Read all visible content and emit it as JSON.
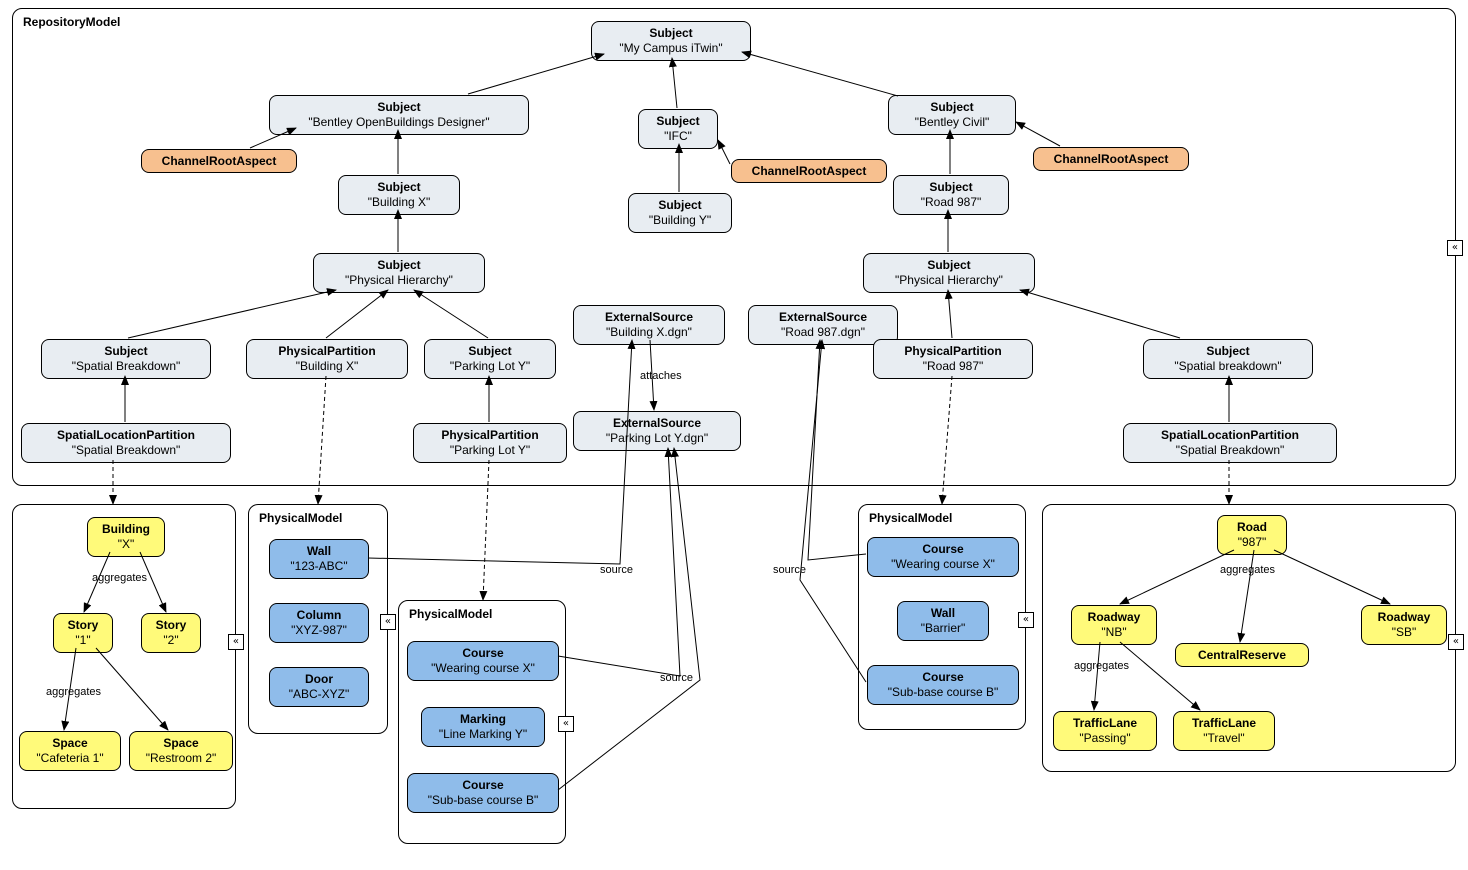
{
  "repo_title": "RepositoryModel",
  "nodes": {
    "root": {
      "t": "Subject",
      "l": "\"My Campus iTwin\""
    },
    "obd": {
      "t": "Subject",
      "l": "\"Bentley OpenBuildings Designer\""
    },
    "ifc": {
      "t": "Subject",
      "l": "\"IFC\""
    },
    "civil": {
      "t": "Subject",
      "l": "\"Bentley Civil\""
    },
    "cra1": {
      "t": "ChannelRootAspect"
    },
    "cra2": {
      "t": "ChannelRootAspect"
    },
    "cra3": {
      "t": "ChannelRootAspect"
    },
    "bx": {
      "t": "Subject",
      "l": "\"Building X\""
    },
    "by": {
      "t": "Subject",
      "l": "\"Building Y\""
    },
    "r987s": {
      "t": "Subject",
      "l": "\"Road 987\""
    },
    "ph1": {
      "t": "Subject",
      "l": "\"Physical Hierarchy\""
    },
    "ph2": {
      "t": "Subject",
      "l": "\"Physical Hierarchy\""
    },
    "sbk1": {
      "t": "Subject",
      "l": "\"Spatial Breakdown\""
    },
    "ppbx": {
      "t": "PhysicalPartition",
      "l": "\"Building X\""
    },
    "sply": {
      "t": "Subject",
      "l": "\"Parking Lot Y\""
    },
    "ppply": {
      "t": "PhysicalPartition",
      "l": "\"Parking Lot Y\""
    },
    "slp1": {
      "t": "SpatialLocationPartition",
      "l": "\"Spatial Breakdown\""
    },
    "esbx": {
      "t": "ExternalSource",
      "l": "\"Building X.dgn\""
    },
    "esr987": {
      "t": "ExternalSource",
      "l": "\"Road 987.dgn\""
    },
    "esply": {
      "t": "ExternalSource",
      "l": "\"Parking Lot Y.dgn\""
    },
    "ppr987": {
      "t": "PhysicalPartition",
      "l": "\"Road 987\""
    },
    "sbk2": {
      "t": "Subject",
      "l": "\"Spatial breakdown\""
    },
    "slp2": {
      "t": "SpatialLocationPartition",
      "l": "\"Spatial Breakdown\""
    }
  },
  "pm1_title": "PhysicalModel",
  "pm1": {
    "wall": {
      "t": "Wall",
      "l": "\"123-ABC\""
    },
    "column": {
      "t": "Column",
      "l": "\"XYZ-987\""
    },
    "door": {
      "t": "Door",
      "l": "\"ABC-XYZ\""
    }
  },
  "pm2_title": "PhysicalModel",
  "pm2": {
    "c1": {
      "t": "Course",
      "l": "\"Wearing course X\""
    },
    "mk": {
      "t": "Marking",
      "l": "\"Line Marking Y\""
    },
    "c2": {
      "t": "Course",
      "l": "\"Sub-base course B\""
    }
  },
  "pm3_title": "PhysicalModel",
  "pm3": {
    "c1": {
      "t": "Course",
      "l": "\"Wearing course X\""
    },
    "wall": {
      "t": "Wall",
      "l": "\"Barrier\""
    },
    "c2": {
      "t": "Course",
      "l": "\"Sub-base course B\""
    }
  },
  "spatial1": {
    "bld": {
      "t": "Building",
      "l": "\"X\""
    },
    "story1": {
      "t": "Story",
      "l": "\"1\""
    },
    "story2": {
      "t": "Story",
      "l": "\"2\""
    },
    "space1": {
      "t": "Space",
      "l": "\"Cafeteria 1\""
    },
    "space2": {
      "t": "Space",
      "l": "\"Restroom 2\""
    }
  },
  "spatial2": {
    "road": {
      "t": "Road",
      "l": "\"987\""
    },
    "rwnb": {
      "t": "Roadway",
      "l": "\"NB\""
    },
    "rwsb": {
      "t": "Roadway",
      "l": "\"SB\""
    },
    "cr": {
      "t": "CentralReserve"
    },
    "tl1": {
      "t": "TrafficLane",
      "l": "\"Passing\""
    },
    "tl2": {
      "t": "TrafficLane",
      "l": "\"Travel\""
    }
  },
  "labels": {
    "attaches": "attaches",
    "aggregates": "aggregates",
    "source": "source"
  }
}
